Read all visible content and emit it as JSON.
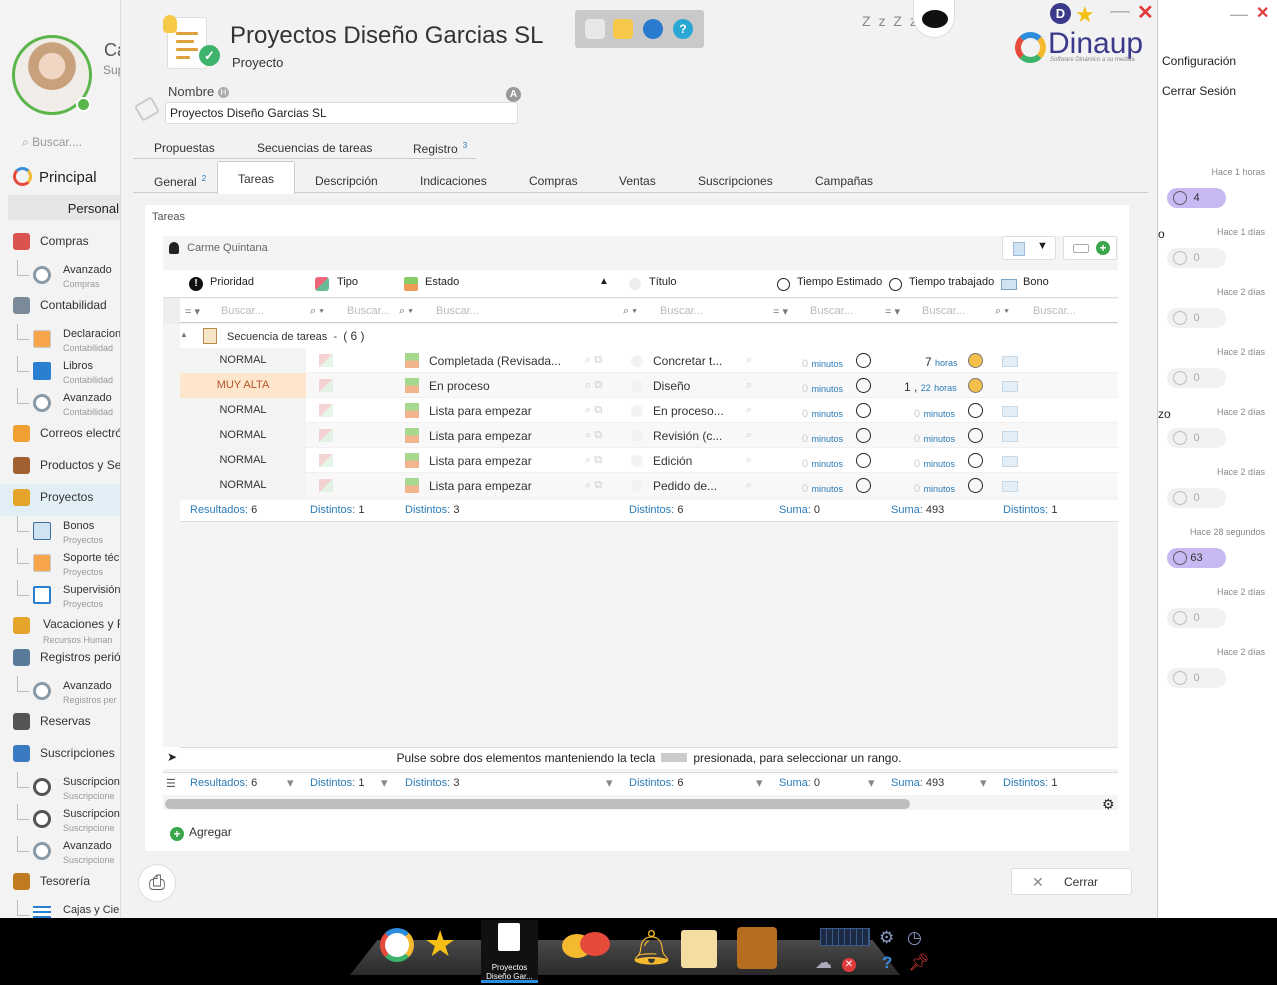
{
  "sidebar": {
    "user_initial": "Ca",
    "user_sub": "Sup",
    "search_placeholder": "Buscar....",
    "principal_label": "Principal",
    "personal_label": "Personal",
    "items": [
      {
        "type": "top",
        "label": "Compras",
        "color": "#d9534f"
      },
      {
        "type": "sub",
        "label": "Avanzado",
        "sub": "Compras"
      },
      {
        "type": "top",
        "label": "Contabilidad",
        "color": "#7a8a99"
      },
      {
        "type": "sub",
        "label": "Declaracion",
        "sub": "Contabilidad",
        "icon": "doc"
      },
      {
        "type": "sub",
        "label": "Libros",
        "sub": "Contabilidad",
        "icon": "book"
      },
      {
        "type": "sub",
        "label": "Avanzado",
        "sub": "Contabilidad"
      },
      {
        "type": "top",
        "label": "Correos electrón",
        "color": "#f0a030"
      },
      {
        "type": "top",
        "label": "Productos y Serv",
        "color": "#a06030"
      },
      {
        "type": "top",
        "label": "Proyectos",
        "color": "#e5a52b",
        "active": true
      },
      {
        "type": "sub",
        "label": "Bonos",
        "sub": "Proyectos",
        "icon": "card"
      },
      {
        "type": "sub",
        "label": "Soporte téc",
        "sub": "Proyectos",
        "icon": "doc"
      },
      {
        "type": "sub",
        "label": "Supervisión",
        "sub": "Proyectos",
        "icon": "search"
      },
      {
        "type": "top2",
        "label": "Vacaciones y Fe",
        "sub": "Recursos Human",
        "color": "#e5a52b"
      },
      {
        "type": "top",
        "label": "Registros periód",
        "color": "#5a7a9a"
      },
      {
        "type": "sub",
        "label": "Avanzado",
        "sub": "Registros per"
      },
      {
        "type": "top",
        "label": "Reservas",
        "color": "#555"
      },
      {
        "type": "top",
        "label": "Suscripciones",
        "color": "#3a7ac0"
      },
      {
        "type": "sub",
        "label": "Suscripcion",
        "sub": "Suscripcione",
        "icon": "clock"
      },
      {
        "type": "sub",
        "label": "Suscripcion",
        "sub": "Suscripcione",
        "icon": "clock"
      },
      {
        "type": "sub",
        "label": "Avanzado",
        "sub": "Suscripcione"
      },
      {
        "type": "top",
        "label": "Tesorería",
        "color": "#c07a20"
      },
      {
        "type": "sub",
        "label": "Cajas y Cier",
        "sub": "",
        "icon": "list"
      }
    ]
  },
  "header": {
    "title": "Proyectos Diseño Garcias SL",
    "subtitle": "Proyecto",
    "zzz": "Z z Z z",
    "user_badge": "D",
    "logo_text": "Dinaup",
    "logo_sub": "Software Dinámico a su medida"
  },
  "form": {
    "nombre_label": "Nombre",
    "nombre_value": "Proyectos Diseño Garcias SL",
    "a_badge": "A"
  },
  "tabs_row1": [
    {
      "label": "Propuestas",
      "sup": ""
    },
    {
      "label": "Secuencias de tareas",
      "sup": ""
    },
    {
      "label": "Registro",
      "sup": "3"
    }
  ],
  "tabs_row2": [
    {
      "label": "General",
      "sup": "2"
    },
    {
      "label": "Tareas",
      "sup": "",
      "active": true
    },
    {
      "label": "Descripción",
      "sup": ""
    },
    {
      "label": "Indicaciones",
      "sup": ""
    },
    {
      "label": "Compras",
      "sup": ""
    },
    {
      "label": "Ventas",
      "sup": ""
    },
    {
      "label": "Suscripciones",
      "sup": ""
    },
    {
      "label": "Campañas",
      "sup": ""
    }
  ],
  "tareas": {
    "section_label": "Tareas",
    "owner": "Carme Quintana",
    "columns": [
      "Prioridad",
      "Tipo",
      "Estado",
      "Título",
      "Tiempo Estimado",
      "Tiempo trabajado",
      "Bono"
    ],
    "search_placeholder": "Buscar...",
    "group_label": "Secuencia de tareas",
    "group_sep": "-",
    "group_count": "( 6 )",
    "rows": [
      {
        "prioridad": "NORMAL",
        "estado": "Completada (Revisada...",
        "titulo": "Concretar t...",
        "est_num": "0",
        "est_unit": "minutos",
        "work_num": "7",
        "work_unit": "horas",
        "work_min": "",
        "high": false,
        "done": true
      },
      {
        "prioridad": "MUY ALTA",
        "estado": "En proceso",
        "titulo": "Diseño",
        "est_num": "0",
        "est_unit": "minutos",
        "work_num": "1",
        "work_unit": "horas",
        "work_min": "22",
        "high": true,
        "done": true
      },
      {
        "prioridad": "NORMAL",
        "estado": "Lista para empezar",
        "titulo": "En proceso...",
        "est_num": "0",
        "est_unit": "minutos",
        "work_num": "0",
        "work_unit": "minutos",
        "work_min": "",
        "high": false,
        "done": false
      },
      {
        "prioridad": "NORMAL",
        "estado": "Lista para empezar",
        "titulo": "Revisión (c...",
        "est_num": "0",
        "est_unit": "minutos",
        "work_num": "0",
        "work_unit": "minutos",
        "work_min": "",
        "high": false,
        "done": false
      },
      {
        "prioridad": "NORMAL",
        "estado": "Lista para empezar",
        "titulo": "Edición",
        "est_num": "0",
        "est_unit": "minutos",
        "work_num": "0",
        "work_unit": "minutos",
        "work_min": "",
        "high": false,
        "done": false
      },
      {
        "prioridad": "NORMAL",
        "estado": "Lista para empezar",
        "titulo": "Pedido de...",
        "est_num": "0",
        "est_unit": "minutos",
        "work_num": "0",
        "work_unit": "minutos",
        "work_min": "",
        "high": false,
        "done": false
      }
    ],
    "summary": [
      {
        "label": "Resultados:",
        "value": "6"
      },
      {
        "label": "Distintos:",
        "value": "1"
      },
      {
        "label": "Distintos:",
        "value": "3"
      },
      {
        "label": "Distintos:",
        "value": "6"
      },
      {
        "label": "Suma:",
        "value": "0"
      },
      {
        "label": "Suma:",
        "value": "493"
      },
      {
        "label": "Distintos:",
        "value": "1"
      }
    ],
    "hint_before": "Pulse sobre dos elementos manteniendo la tecla",
    "hint_after": "presionada, para seleccionar un rango.",
    "add_label": "Agregar"
  },
  "footer": {
    "close_label": "Cerrar"
  },
  "right_panel": {
    "config_label": "Configuración",
    "logout_label": "Cerrar Sesión",
    "notifications": [
      {
        "time": "Hace 1 horas",
        "count": "4",
        "active": true,
        "frag": ""
      },
      {
        "time": "Hace 1 días",
        "count": "0",
        "active": false,
        "frag": "o"
      },
      {
        "time": "Hace 2 días",
        "count": "0",
        "active": false,
        "frag": ""
      },
      {
        "time": "Hace 2 días",
        "count": "0",
        "active": false,
        "frag": ""
      },
      {
        "time": "Hace 2 días",
        "count": "0",
        "active": false,
        "frag": "zo"
      },
      {
        "time": "Hace 2 días",
        "count": "0",
        "active": false,
        "frag": ""
      },
      {
        "time": "Hace 28 segundos",
        "count": "63",
        "active": true,
        "frag": ""
      },
      {
        "time": "Hace 2 días",
        "count": "0",
        "active": false,
        "frag": ""
      },
      {
        "time": "Hace 2 días",
        "count": "0",
        "active": false,
        "frag": ""
      }
    ]
  },
  "taskbar": {
    "active_label": "Proyectos Diseño Gar..."
  }
}
